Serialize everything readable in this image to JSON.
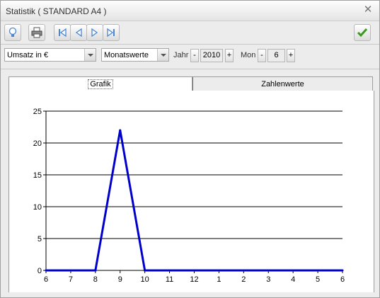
{
  "window": {
    "title": "Statistik ( STANDARD A4 )",
    "close_icon": "close-icon"
  },
  "toolbar": {
    "icons": [
      "lightbulb-icon",
      "print-icon",
      "first-record-icon",
      "previous-record-icon",
      "next-record-icon",
      "last-record-icon",
      "ok-checkmark-icon"
    ],
    "accent_color": "#4a86d1",
    "ok_color": "#3a9a1e"
  },
  "filters": {
    "measure": "Umsatz in €",
    "period_type": "Monatswerte",
    "year_label": "Jahr",
    "year_value": "2010",
    "month_label": "Mon",
    "month_value": "6",
    "minus": "-",
    "plus": "+"
  },
  "tabs": [
    {
      "label": "Grafik",
      "active": true
    },
    {
      "label": "Zahlenwerte",
      "active": false
    }
  ],
  "chart_data": {
    "type": "line",
    "title": "",
    "xlabel": "",
    "ylabel": "",
    "categories": [
      "6",
      "7",
      "8",
      "9",
      "10",
      "11",
      "12",
      "1",
      "2",
      "3",
      "4",
      "5",
      "6"
    ],
    "series": [
      {
        "values": [
          0,
          0,
          0,
          22,
          0,
          0,
          0,
          0,
          0,
          0,
          0,
          0,
          0
        ],
        "color": "#0000cc"
      }
    ],
    "ylim": [
      0,
      25
    ],
    "yticks": [
      "0",
      "5",
      "10",
      "15",
      "20",
      "25"
    ],
    "grid": true,
    "legend": "none"
  }
}
